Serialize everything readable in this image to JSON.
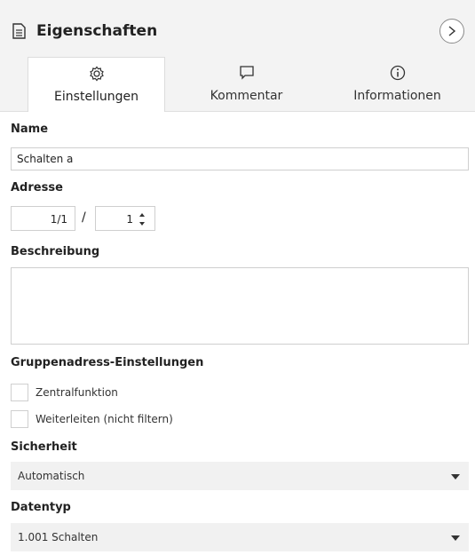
{
  "header": {
    "title": "Eigenschaften",
    "icons": {
      "document": "document-icon",
      "collapse": "chevron-right-icon"
    }
  },
  "tabs": [
    {
      "label": "Einstellungen",
      "icon": "gear-icon",
      "active": true
    },
    {
      "label": "Kommentar",
      "icon": "comment-icon",
      "active": false
    },
    {
      "label": "Informationen",
      "icon": "info-icon",
      "active": false
    }
  ],
  "form": {
    "name": {
      "label": "Name",
      "value": "Schalten a"
    },
    "address": {
      "label": "Adresse",
      "main": "1/1",
      "separator": "/",
      "sub": "1"
    },
    "description": {
      "label": "Beschreibung",
      "value": ""
    },
    "group_settings": {
      "label": "Gruppenadress-Einstellungen",
      "options": [
        {
          "label": "Zentralfunktion",
          "checked": false
        },
        {
          "label": "Weiterleiten (nicht filtern)",
          "checked": false
        }
      ]
    },
    "security": {
      "label": "Sicherheit",
      "value": "Automatisch"
    },
    "datatype": {
      "label": "Datentyp",
      "value": "1.001 Schalten"
    }
  },
  "colors": {
    "header_bg": "#f3f3f3",
    "border": "#cfcfcf",
    "select_bg": "#f1f1f1"
  }
}
